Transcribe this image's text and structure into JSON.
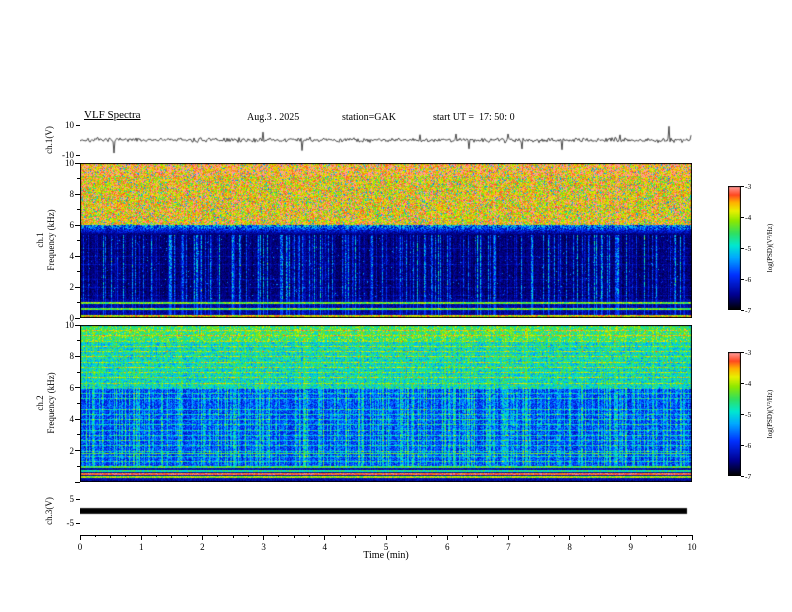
{
  "header": {
    "title": "VLF Spectra",
    "date": "Aug.3 . 2025",
    "station": "station=GAK",
    "start_ut": "start UT =  17: 50: 0"
  },
  "colors": {
    "background": "#ffffff",
    "foreground": "#000000"
  },
  "colormap": {
    "label": "log(PSD)(V²/Hz)",
    "min": -7,
    "max": -3,
    "stops": [
      {
        "t": 0.0,
        "color": "#000000"
      },
      {
        "t": 0.12,
        "color": "#00008f"
      },
      {
        "t": 0.28,
        "color": "#0030ff"
      },
      {
        "t": 0.42,
        "color": "#00a8ff"
      },
      {
        "t": 0.52,
        "color": "#00e8d0"
      },
      {
        "t": 0.62,
        "color": "#30e060"
      },
      {
        "t": 0.72,
        "color": "#8ce800"
      },
      {
        "t": 0.8,
        "color": "#e8f000"
      },
      {
        "t": 0.87,
        "color": "#ffb000"
      },
      {
        "t": 0.93,
        "color": "#ff4820"
      },
      {
        "t": 1.0,
        "color": "#ff9e9e"
      }
    ]
  },
  "axes": {
    "x": {
      "label": "Time (min)",
      "min": 0,
      "max": 10,
      "ticks": [
        0,
        1,
        2,
        3,
        4,
        5,
        6,
        7,
        8,
        9,
        10
      ]
    },
    "ch1_wave": {
      "label": "ch.1(V)",
      "min": -10,
      "max": 10,
      "tick_labels": [
        10,
        -10
      ]
    },
    "ch1_spec": {
      "label_line1": "ch.1",
      "label_line2": "Frequency (kHz)",
      "min": 0,
      "max": 10,
      "tick_labels": [
        10,
        8,
        6,
        4,
        2,
        0
      ]
    },
    "ch2_spec": {
      "label_line1": "ch.2",
      "label_line2": "Frequency (kHz)",
      "min": 0,
      "max": 10,
      "tick_labels": [
        10,
        8,
        6,
        4,
        2
      ]
    },
    "ch3_wave": {
      "label": "ch.3(V)",
      "min": -10,
      "max": 10,
      "tick_labels": [
        5,
        -5
      ]
    },
    "colorbar": {
      "label": "log(PSD)(V²/Hz)",
      "tick_labels": [
        -3,
        -4,
        -5,
        -6,
        -7
      ]
    }
  },
  "chart_data": [
    {
      "type": "line",
      "name": "ch.1 time series",
      "xlabel": "Time (min)",
      "xlim": [
        0,
        10
      ],
      "ylabel": "ch.1(V)",
      "ylim": [
        -10,
        10
      ],
      "description": "Broadband VLF noise centred on 0 V (±1–2 V) with frequent impulsive sferic spikes reaching ±4 to ±10 V",
      "seed": 7,
      "noise_sigma": 1.0,
      "spike_prob": 0.028,
      "spike_min": 3,
      "spike_max": 9.5
    },
    {
      "type": "heatmap",
      "name": "ch.1 spectrogram",
      "xlabel": "Time (min)",
      "xlim": [
        0,
        10
      ],
      "ylabel": "Frequency (kHz)",
      "ylim": [
        0,
        10
      ],
      "zlabel": "log(PSD)(V²/Hz)",
      "zlim": [
        -7,
        -3
      ],
      "model": "ch1",
      "seed": 11,
      "features": [
        "intense broadband hiss above ~6 kHz (green/yellow, red flecks near 10 kHz, PSD ≈ -4 to -3)",
        "quiet dark band ~1–5.5 kHz (PSD ≈ -7) crossed by vertical blue sferic streaks",
        "bright multicoloured power-line band below ~1.2 kHz with lines near 0.2, 0.6 and 1.0 kHz"
      ]
    },
    {
      "type": "heatmap",
      "name": "ch.2 spectrogram",
      "xlabel": "Time (min)",
      "xlim": [
        0,
        10
      ],
      "ylabel": "Frequency (kHz)",
      "ylim": [
        0,
        10
      ],
      "zlabel": "log(PSD)(V²/Hz)",
      "zlim": [
        -7,
        -3
      ],
      "model": "ch2",
      "seed": 23,
      "features": [
        "cyan-green hiss above ~6 kHz (PSD ≈ -5 to -4)",
        "blue speckled background 0–6 kHz with dense vertical sferic streaks",
        "many thin horizontal harmonic lines (~0.33 kHz spacing), brighter lines near 1.0 and 1.9 kHz",
        "strong lines below 1 kHz including a red line near 0.55 kHz"
      ]
    },
    {
      "type": "line",
      "name": "ch.3 time series",
      "xlabel": "Time (min)",
      "xlim": [
        0,
        10
      ],
      "ylabel": "ch.3(V)",
      "ylim": [
        -10,
        10
      ],
      "description": "Flat saturated/quiet trace at 0 V for the whole interval (thick black band)",
      "seed": 5,
      "bar_halfwidth_v": 1.2
    }
  ]
}
